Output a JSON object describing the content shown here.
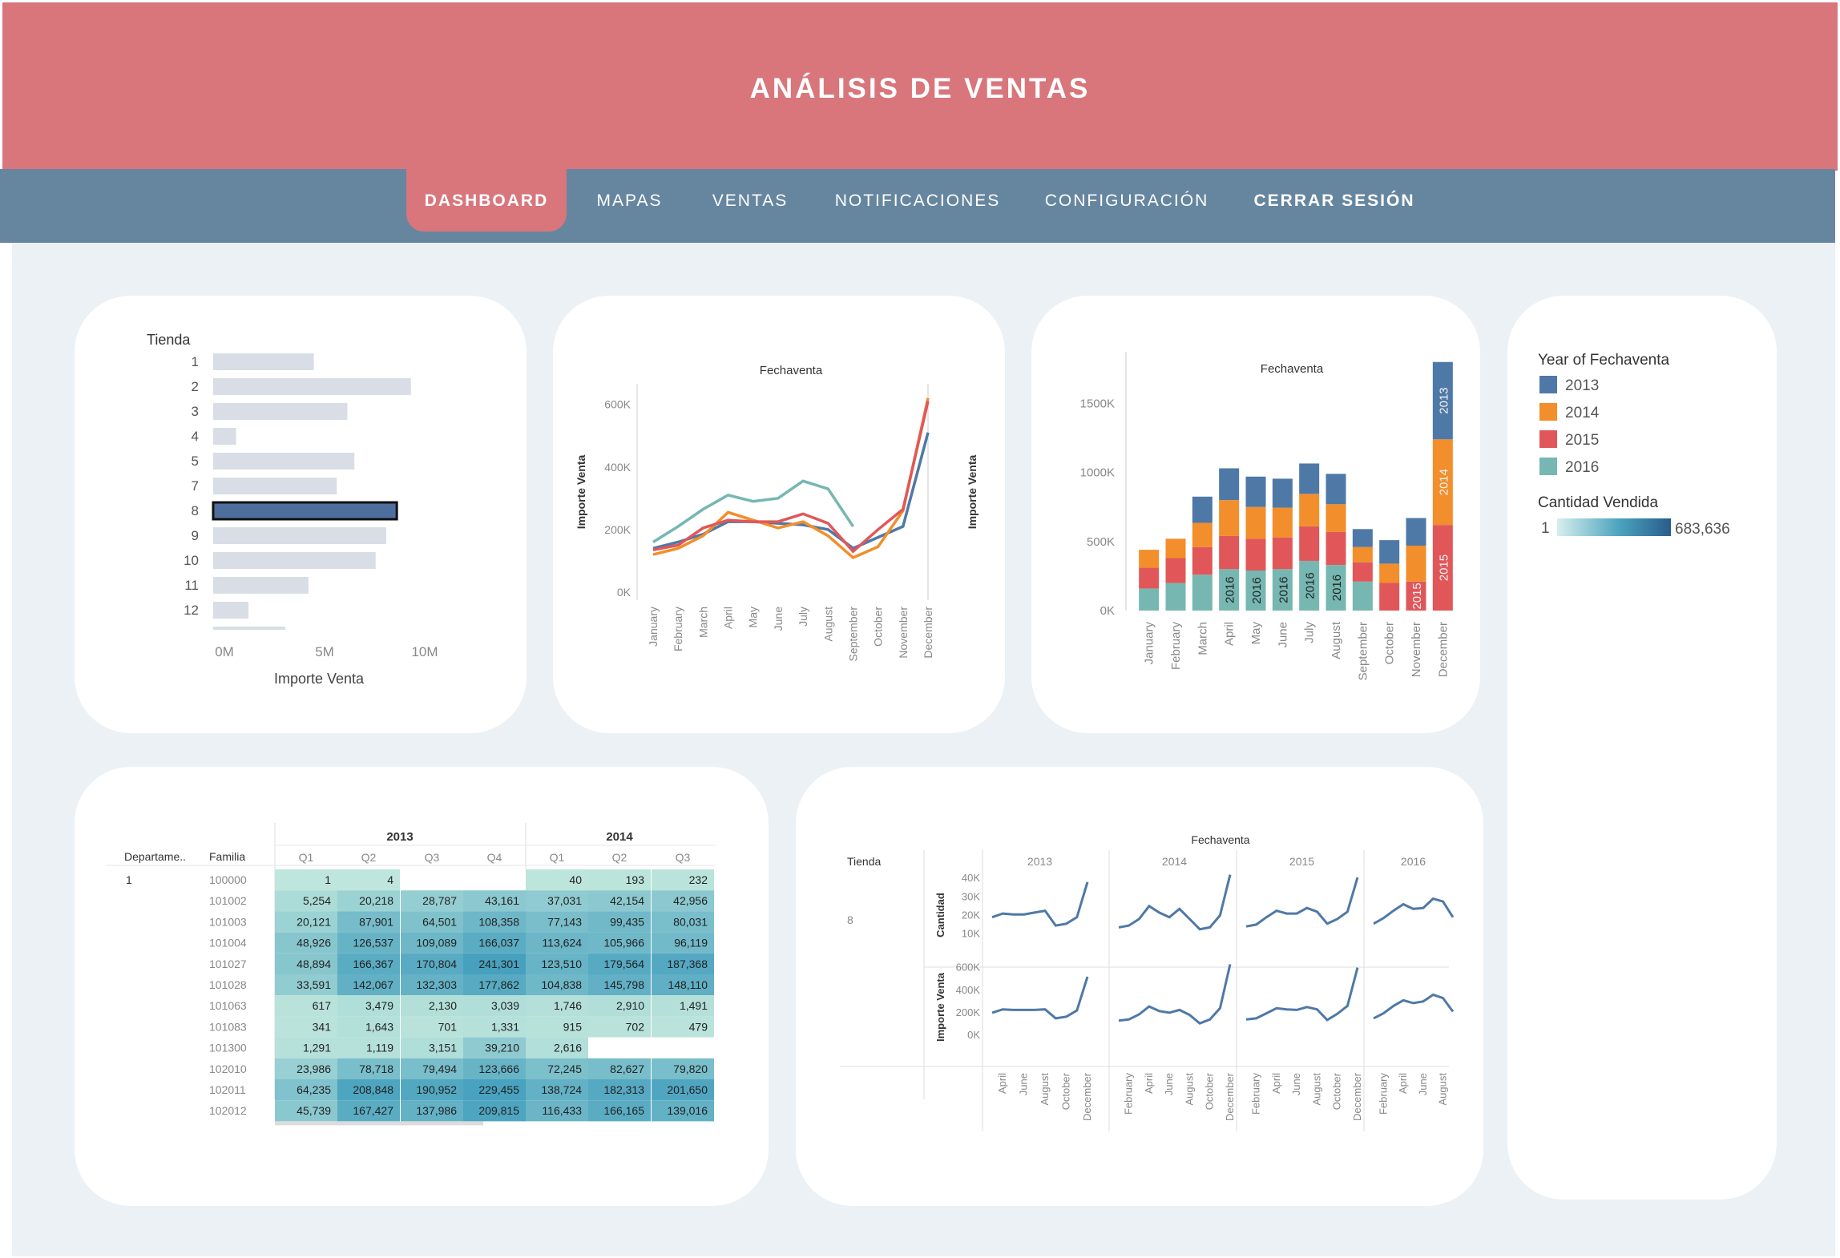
{
  "app": {
    "title": "ANÁLISIS DE VENTAS"
  },
  "nav": {
    "items": [
      {
        "label": "DASHBOARD",
        "active": true
      },
      {
        "label": "MAPAS"
      },
      {
        "label": "VENTAS"
      },
      {
        "label": "NOTIFICACIONES"
      },
      {
        "label": "CONFIGURACIÓN"
      },
      {
        "label": "CERRAR SESIÓN"
      }
    ]
  },
  "colors": {
    "header": "#d8767c",
    "nav": "#66869f",
    "background": "#ebf1f4",
    "2013": "#4e79a7",
    "2014": "#f28e2b",
    "2015": "#e15759",
    "2016": "#76b7b2",
    "bar_default": "#d9dee6",
    "bar_selected": "#4e6f9e"
  },
  "legend": {
    "year_title": "Year of Fechaventa",
    "years": [
      "2013",
      "2014",
      "2015",
      "2016"
    ],
    "qty_title": "Cantidad Vendida",
    "qty_min": "1",
    "qty_max": "683,636"
  },
  "chart_data": [
    {
      "id": "tienda-bars",
      "type": "bar",
      "orientation": "horizontal",
      "header": "Tienda",
      "categories": [
        "1",
        "2",
        "3",
        "4",
        "5",
        "7",
        "8",
        "9",
        "10",
        "11",
        "12"
      ],
      "values": [
        5.7,
        11.2,
        7.6,
        1.3,
        8.0,
        7.0,
        10.4,
        9.8,
        9.2,
        5.4,
        2.0
      ],
      "selected": "8",
      "xlabel": "Importe Venta",
      "xticks": [
        "0M",
        "5M",
        "10M"
      ],
      "xlim": [
        0,
        12.5
      ]
    },
    {
      "id": "monthly-lines",
      "type": "line",
      "title": "Fechaventa",
      "ylabel": "Importe Venta",
      "ylabel_right": "Importe Venta",
      "yticks": [
        "0K",
        "200K",
        "400K",
        "600K"
      ],
      "ylim": [
        0,
        640000
      ],
      "categories": [
        "January",
        "February",
        "March",
        "April",
        "May",
        "June",
        "July",
        "August",
        "September",
        "October",
        "November",
        "December"
      ],
      "series": [
        {
          "name": "2013",
          "values": [
            140000,
            160000,
            185000,
            225000,
            225000,
            220000,
            215000,
            200000,
            140000,
            175000,
            210000,
            510000
          ]
        },
        {
          "name": "2014",
          "values": [
            120000,
            140000,
            180000,
            255000,
            230000,
            205000,
            225000,
            180000,
            110000,
            145000,
            260000,
            620000
          ]
        },
        {
          "name": "2015",
          "values": [
            135000,
            150000,
            205000,
            230000,
            225000,
            225000,
            250000,
            220000,
            130000,
            200000,
            265000,
            610000
          ]
        },
        {
          "name": "2016",
          "values": [
            160000,
            210000,
            265000,
            310000,
            290000,
            300000,
            355000,
            330000,
            210000,
            null,
            null,
            null
          ]
        }
      ]
    },
    {
      "id": "monthly-stacked",
      "type": "bar",
      "stacked": true,
      "title": "Fechaventa",
      "yticks": [
        "0K",
        "500K",
        "1000K",
        "1500K"
      ],
      "ylim": [
        0,
        1700000
      ],
      "categories": [
        "January",
        "February",
        "March",
        "April",
        "May",
        "June",
        "July",
        "August",
        "September",
        "October",
        "November",
        "December"
      ],
      "series": [
        {
          "name": "2016",
          "values": [
            160000,
            200000,
            260000,
            300000,
            290000,
            300000,
            360000,
            330000,
            210000,
            0,
            0,
            0
          ]
        },
        {
          "name": "2015",
          "values": [
            150000,
            180000,
            200000,
            240000,
            230000,
            230000,
            250000,
            240000,
            140000,
            200000,
            210000,
            620000
          ]
        },
        {
          "name": "2014",
          "values": [
            130000,
            140000,
            175000,
            260000,
            230000,
            215000,
            235000,
            200000,
            110000,
            140000,
            260000,
            620000
          ]
        },
        {
          "name": "2013",
          "values": [
            0,
            0,
            190000,
            230000,
            220000,
            210000,
            220000,
            220000,
            130000,
            170000,
            200000,
            560000
          ]
        }
      ],
      "in_bar_labels": [
        {
          "category": "April",
          "series": "2016",
          "text": "2016"
        },
        {
          "category": "May",
          "series": "2016",
          "text": "2016"
        },
        {
          "category": "June",
          "series": "2016",
          "text": "2016"
        },
        {
          "category": "July",
          "series": "2016",
          "text": "2016"
        },
        {
          "category": "August",
          "series": "2016",
          "text": "2016"
        },
        {
          "category": "November",
          "series": "2015",
          "text": "2015"
        },
        {
          "category": "December",
          "series": "2015",
          "text": "2015"
        },
        {
          "category": "December",
          "series": "2014",
          "text": "2014"
        },
        {
          "category": "December",
          "series": "2013",
          "text": "2013"
        }
      ]
    },
    {
      "id": "heat-table",
      "type": "table",
      "row_headers": [
        "Departame..",
        "Familia"
      ],
      "years": [
        "2013",
        "2014"
      ],
      "year_spans": [
        4,
        3
      ],
      "quarters": [
        "Q1",
        "Q2",
        "Q3",
        "Q4",
        "Q1",
        "Q2",
        "Q3"
      ],
      "departamento": "1",
      "rows": [
        {
          "familia": "100000",
          "cells": [
            "1",
            "4",
            "",
            "",
            "40",
            "193",
            "232"
          ]
        },
        {
          "familia": "101002",
          "cells": [
            "5,254",
            "20,218",
            "28,787",
            "43,161",
            "37,031",
            "42,154",
            "42,956"
          ]
        },
        {
          "familia": "101003",
          "cells": [
            "20,121",
            "87,901",
            "64,501",
            "108,358",
            "77,143",
            "99,435",
            "80,031"
          ]
        },
        {
          "familia": "101004",
          "cells": [
            "48,926",
            "126,537",
            "109,089",
            "166,037",
            "113,624",
            "105,966",
            "96,119"
          ]
        },
        {
          "familia": "101027",
          "cells": [
            "48,894",
            "166,367",
            "170,804",
            "241,301",
            "123,510",
            "179,564",
            "187,368"
          ]
        },
        {
          "familia": "101028",
          "cells": [
            "33,591",
            "142,067",
            "132,303",
            "177,862",
            "104,838",
            "145,798",
            "148,110"
          ]
        },
        {
          "familia": "101063",
          "cells": [
            "617",
            "3,479",
            "2,130",
            "3,039",
            "1,746",
            "2,910",
            "1,491"
          ]
        },
        {
          "familia": "101083",
          "cells": [
            "341",
            "1,643",
            "701",
            "1,331",
            "915",
            "702",
            "479"
          ]
        },
        {
          "familia": "101300",
          "cells": [
            "1,291",
            "1,119",
            "3,151",
            "39,210",
            "2,616",
            "",
            ""
          ]
        },
        {
          "familia": "102010",
          "cells": [
            "23,986",
            "78,718",
            "79,494",
            "123,666",
            "72,245",
            "82,627",
            "79,820"
          ]
        },
        {
          "familia": "102011",
          "cells": [
            "64,235",
            "208,848",
            "190,952",
            "229,455",
            "138,724",
            "182,313",
            "201,650"
          ]
        },
        {
          "familia": "102012",
          "cells": [
            "45,739",
            "167,427",
            "137,986",
            "209,815",
            "116,433",
            "166,165",
            "139,016"
          ]
        }
      ]
    },
    {
      "id": "small-multiples",
      "type": "line",
      "title": "Fechaventa",
      "row_header": "Tienda",
      "tienda": "8",
      "years": [
        "2013",
        "2014",
        "2015",
        "2016"
      ],
      "measures": [
        {
          "name": "Cantidad",
          "yticks": [
            "10K",
            "20K",
            "30K",
            "40K"
          ],
          "ylim": [
            5000,
            44000
          ]
        },
        {
          "name": "Importe Venta",
          "yticks": [
            "0K",
            "200K",
            "400K",
            "600K"
          ],
          "ylim": [
            0,
            640000
          ]
        }
      ],
      "panels": [
        {
          "year": "2013",
          "months": [
            "March",
            "April",
            "May",
            "June",
            "July",
            "August",
            "September",
            "October",
            "November",
            "December"
          ],
          "xticks": [
            "April",
            "June",
            "August",
            "October",
            "December"
          ],
          "cantidad": [
            19000,
            21000,
            20500,
            20500,
            21500,
            22500,
            14500,
            15500,
            19000,
            38000
          ],
          "importe": [
            200000,
            230000,
            225000,
            225000,
            225000,
            230000,
            150000,
            165000,
            220000,
            520000
          ]
        },
        {
          "year": "2014",
          "months": [
            "January",
            "February",
            "March",
            "April",
            "May",
            "June",
            "July",
            "August",
            "September",
            "October",
            "November",
            "December"
          ],
          "xticks": [
            "February",
            "April",
            "June",
            "August",
            "October",
            "December"
          ],
          "cantidad": [
            13500,
            14500,
            18000,
            25000,
            21500,
            19000,
            23500,
            18000,
            12500,
            13500,
            20000,
            42000
          ],
          "importe": [
            130000,
            140000,
            185000,
            255000,
            215000,
            200000,
            225000,
            180000,
            105000,
            140000,
            240000,
            630000
          ]
        },
        {
          "year": "2015",
          "months": [
            "January",
            "February",
            "March",
            "April",
            "May",
            "June",
            "July",
            "August",
            "September",
            "October",
            "November",
            "December"
          ],
          "xticks": [
            "February",
            "April",
            "June",
            "August",
            "October",
            "December"
          ],
          "cantidad": [
            14000,
            15000,
            19000,
            22500,
            21000,
            21000,
            24000,
            22000,
            15500,
            18000,
            22000,
            40500
          ],
          "importe": [
            140000,
            150000,
            195000,
            240000,
            230000,
            225000,
            250000,
            230000,
            135000,
            190000,
            260000,
            600000
          ]
        },
        {
          "year": "2016",
          "months": [
            "January",
            "February",
            "March",
            "April",
            "May",
            "June",
            "July",
            "August",
            "September"
          ],
          "xticks": [
            "February",
            "April",
            "June",
            "August"
          ],
          "cantidad": [
            15500,
            18500,
            22500,
            26000,
            23500,
            24000,
            29000,
            27500,
            19000
          ],
          "importe": [
            150000,
            195000,
            260000,
            310000,
            285000,
            300000,
            360000,
            330000,
            210000
          ]
        }
      ]
    }
  ]
}
